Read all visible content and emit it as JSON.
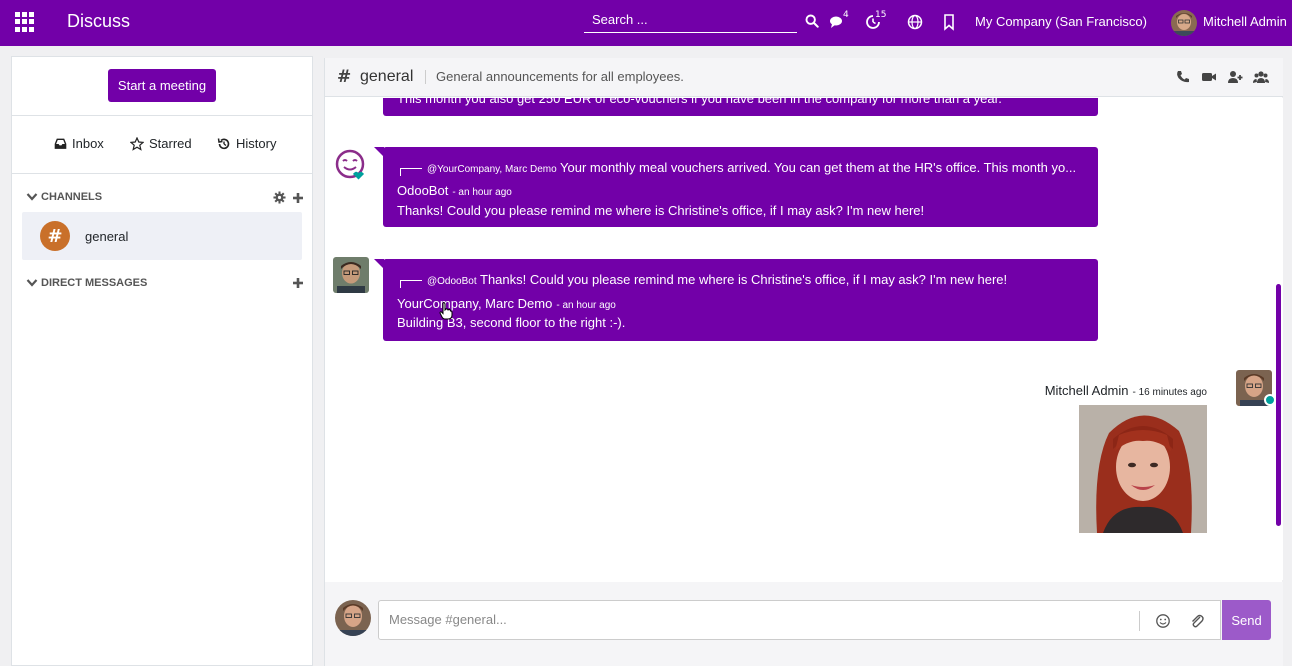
{
  "topbar": {
    "app_title": "Discuss",
    "search_placeholder": "Search ...",
    "messages_badge": "4",
    "activities_badge": "15",
    "company": "My Company (San Francisco)",
    "user_name": "Mitchell Admin"
  },
  "sidebar": {
    "start_meeting": "Start a meeting",
    "mailboxes": [
      {
        "label": "Inbox",
        "icon": "inbox-icon"
      },
      {
        "label": "Starred",
        "icon": "star-icon"
      },
      {
        "label": "History",
        "icon": "history-icon"
      }
    ],
    "channels_label": "CHANNELS",
    "channels": [
      {
        "name": "general"
      }
    ],
    "direct_messages_label": "DIRECT MESSAGES"
  },
  "thread": {
    "name": "general",
    "description": "General announcements for all employees.",
    "partial_message": "This month you also get 250 EUR of eco-vouchers if you have been in the company for more than a year.",
    "messages": [
      {
        "reply_author": "@YourCompany, Marc Demo",
        "reply_text": "Your monthly meal vouchers arrived. You can get them at the HR's office. This month yo...",
        "author": "OdooBot",
        "date": "- an hour ago",
        "body": "Thanks! Could you please remind me where is Christine's office, if I may ask? I'm new here!"
      },
      {
        "reply_author": "@OdooBot",
        "reply_text": "Thanks! Could you please remind me where is Christine's office, if I may ask? I'm new here!",
        "author": "YourCompany, Marc Demo",
        "date": "- an hour ago",
        "body": "Building B3, second floor to the right :-)."
      }
    ],
    "own_message": {
      "author": "Mitchell Admin",
      "date": "- 16 minutes ago"
    }
  },
  "composer": {
    "placeholder": "Message #general...",
    "send_label": "Send"
  },
  "colors": {
    "brand": "#7200a8",
    "send": "#9c5ac9",
    "online": "#00a09d"
  }
}
